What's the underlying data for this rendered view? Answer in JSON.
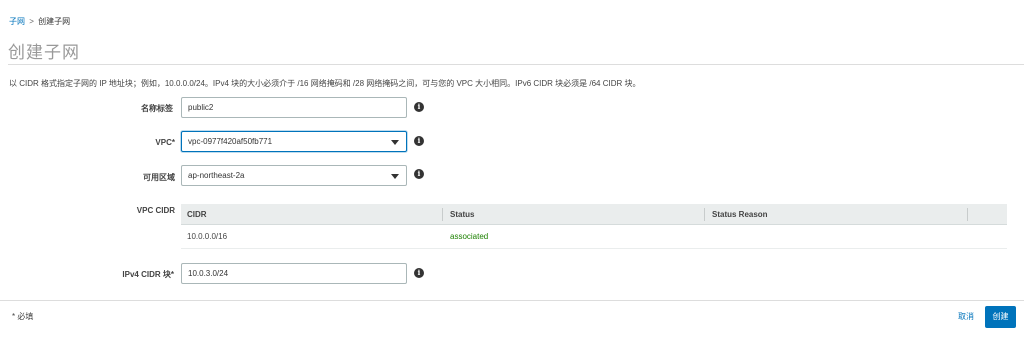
{
  "breadcrumb": {
    "parent": "子网",
    "separator": ">",
    "current": "创建子网"
  },
  "page_title": "创建子网",
  "description": "以 CIDR 格式指定子网的 IP 地址块；例如，10.0.0.0/24。IPv4 块的大小必须介于 /16 网络掩码和 /28 网络掩码之间，可与您的 VPC 大小相同。IPv6 CIDR 块必须是 /64 CIDR 块。",
  "form": {
    "name_tag": {
      "label": "名称标签",
      "value": "public2"
    },
    "vpc": {
      "label": "VPC",
      "required_mark": "*",
      "value": "vpc-0977f420af50fb771"
    },
    "az": {
      "label": "可用区域",
      "value": "ap-northeast-2a"
    },
    "vpc_cidr": {
      "label": "VPC CIDR",
      "columns": [
        "CIDR",
        "Status",
        "Status Reason"
      ],
      "rows": [
        {
          "cidr": "10.0.0.0/16",
          "status": "associated",
          "reason": ""
        }
      ],
      "status_color": "#1d8102"
    },
    "ipv4_cidr": {
      "label": "IPv4 CIDR 块",
      "required_mark": "*",
      "value": "10.0.3.0/24"
    }
  },
  "info_icon_glyph": "i",
  "footer": {
    "required_note": "* 必填",
    "cancel_label": "取消",
    "create_label": "创建"
  },
  "colors": {
    "link": "#0073bb",
    "primary_button": "#0073bb"
  },
  "icons": {
    "info": "info-icon",
    "dropdown": "caret-down-icon"
  }
}
